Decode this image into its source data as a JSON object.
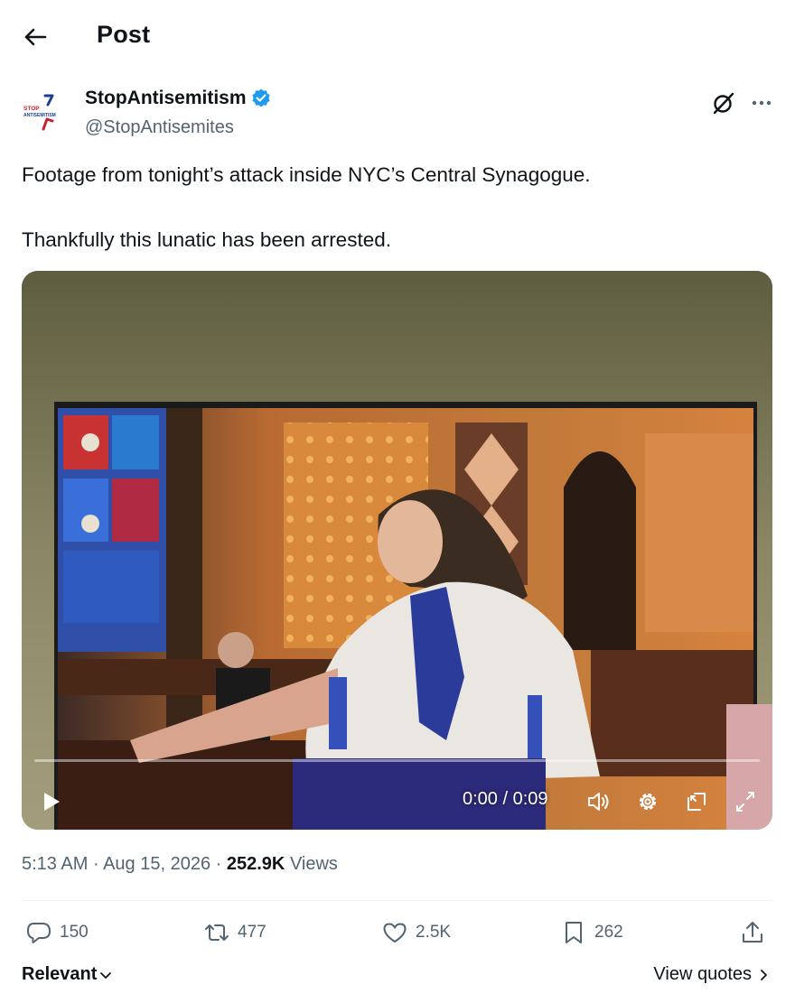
{
  "header": {
    "title": "Post",
    "back_icon": "arrow-left-icon"
  },
  "author": {
    "display_name": "StopAntisemitism",
    "handle": "@StopAntisemites",
    "verified": true,
    "verified_color": "#1d9bf0",
    "avatar_text_top": "STOP",
    "avatar_text_bottom": "ANTISEMITISM",
    "avatar_colors": {
      "blue": "#1b3f94",
      "red": "#c8202f"
    }
  },
  "post": {
    "text_line_1": "Footage from tonight’s attack inside NYC’s Central Synagogue.",
    "text_line_2": "Thankfully this lunatic has been arrested."
  },
  "video": {
    "timecode": "0:00 / 0:09",
    "progress": 0,
    "controls": [
      "play-icon",
      "volume-icon",
      "settings-gear-icon",
      "pip-icon",
      "fullscreen-icon"
    ]
  },
  "meta": {
    "time": "5:13 AM",
    "separator": "·",
    "date": "Aug 15, 2026",
    "views_count": "252.9K",
    "views_label": "Views"
  },
  "actions": {
    "replies": "150",
    "reposts": "477",
    "likes": "2.5K",
    "bookmarks": "262"
  },
  "footer": {
    "sort_label": "Relevant",
    "view_quotes_label": "View quotes"
  },
  "colors": {
    "text_primary": "#0f1419",
    "text_secondary": "#536471",
    "divider": "#eff3f4"
  }
}
